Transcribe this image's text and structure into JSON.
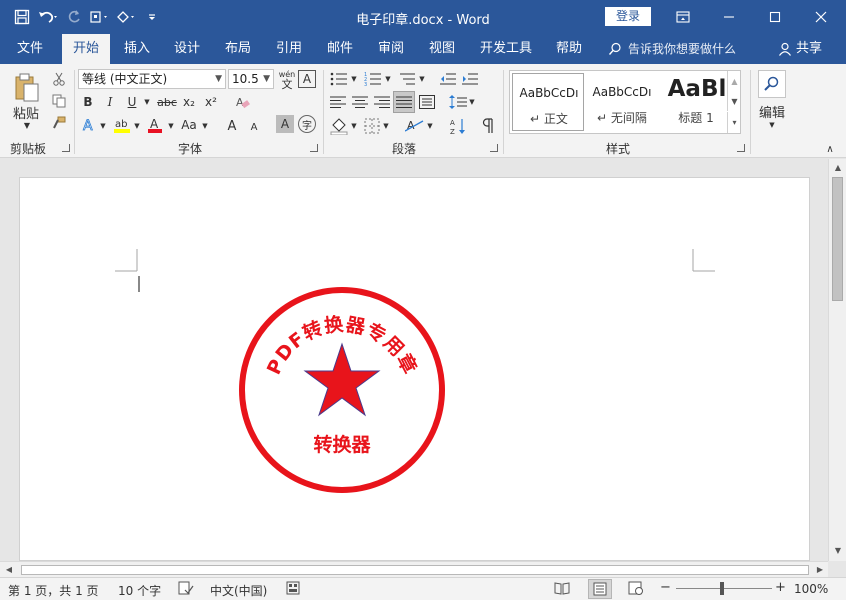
{
  "window": {
    "title": "电子印章.docx  -  Word",
    "login": "登录"
  },
  "tabs": [
    "文件",
    "开始",
    "插入",
    "设计",
    "布局",
    "引用",
    "邮件",
    "审阅",
    "视图",
    "开发工具",
    "帮助"
  ],
  "tell_me": "告诉我你想要做什么",
  "share": "共享",
  "ribbon": {
    "clipboard": {
      "paste": "粘贴",
      "label": "剪贴板"
    },
    "font": {
      "name": "等线 (中文正文)",
      "size": "10.5",
      "label": "字体",
      "bold": "B",
      "italic": "I",
      "underline": "U",
      "strike": "abc",
      "sub": "x₂",
      "sup": "x²",
      "grow": "A",
      "shrink": "A",
      "case": "Aa",
      "phonetic_top": "wén",
      "phonetic_bottom": "文",
      "border_char": "A",
      "shading_char": "A",
      "enclose": "字"
    },
    "paragraph": {
      "label": "段落"
    },
    "styles": {
      "label": "样式",
      "items": [
        {
          "preview": "AaBbCcDı",
          "name": "正文"
        },
        {
          "preview": "AaBbCcDı",
          "name": "无间隔"
        },
        {
          "preview": "AaBl",
          "name": "标题 1"
        }
      ]
    },
    "editing": {
      "label": "编辑"
    }
  },
  "stamp": {
    "ring_text": "PDF转换器专用章",
    "bottom_text": "转换器",
    "color": "#e8141b",
    "star_color": "#e8141b",
    "star_outline": "#4a3a8c"
  },
  "status": {
    "page": "第 1 页，共 1 页",
    "words": "10 个字",
    "language": "中文(中国)",
    "zoom": "100%"
  },
  "colors": {
    "accent": "#2b579a",
    "ribbon_bg": "#f3f3f3"
  }
}
